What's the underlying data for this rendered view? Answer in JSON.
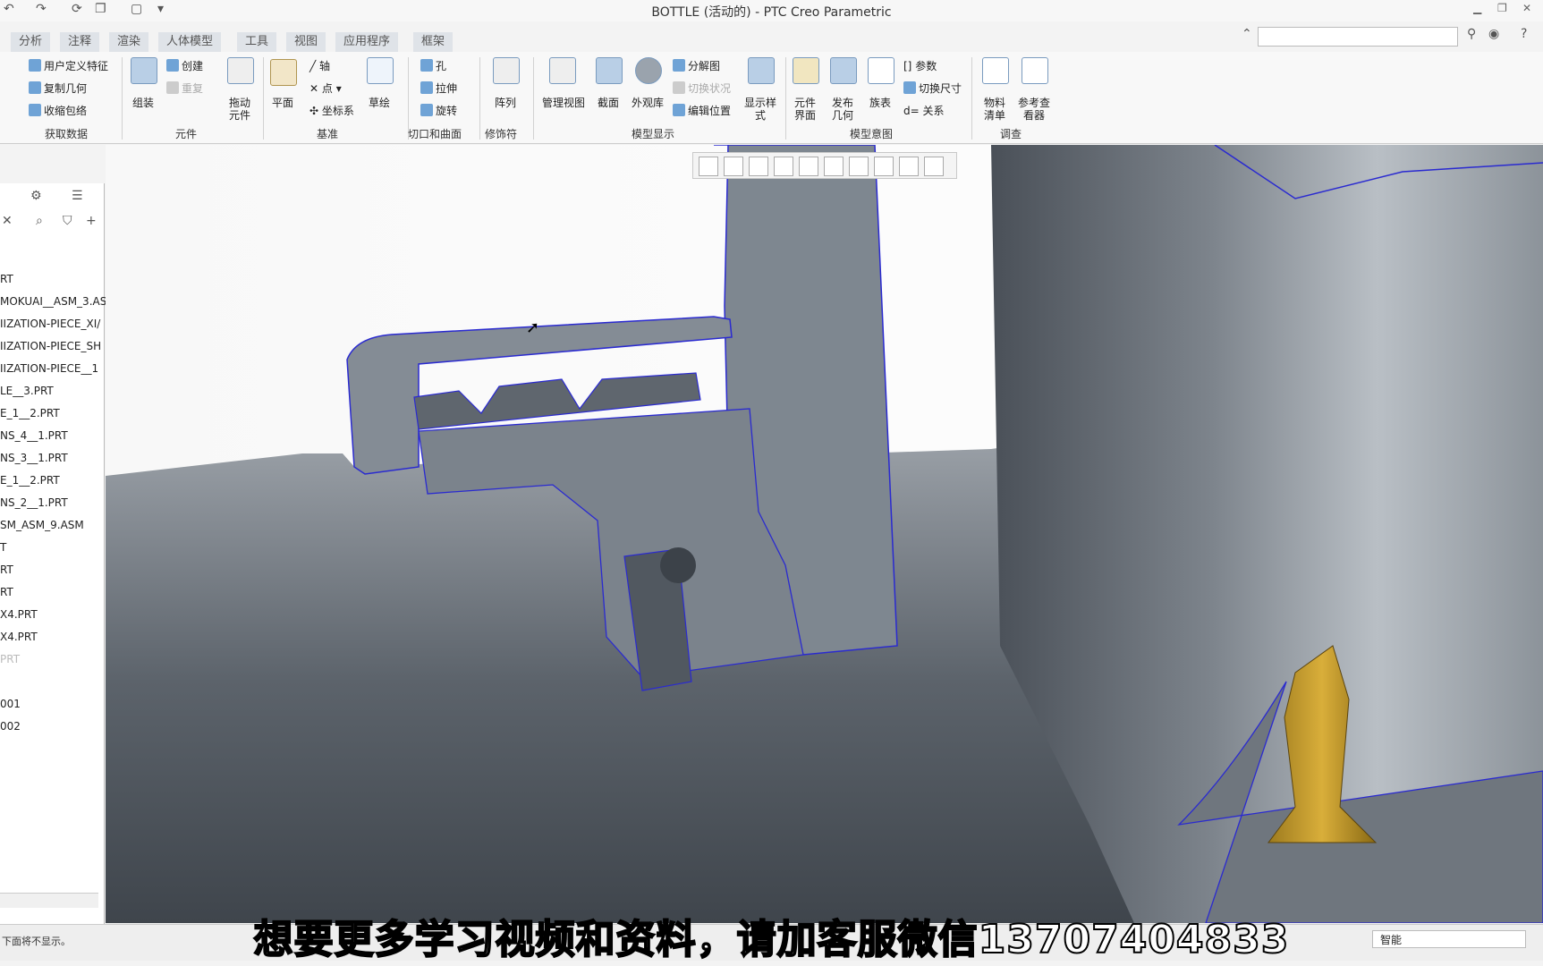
{
  "window": {
    "title": "BOTTLE (活动的) - PTC Creo Parametric"
  },
  "tabs": [
    "分析",
    "注释",
    "渲染",
    "人体模型",
    "工具",
    "视图",
    "应用程序",
    "框架"
  ],
  "ribbon": {
    "get_data": {
      "items": [
        "用户定义特征",
        "复制几何",
        "收缩包络"
      ],
      "group": "获取数据"
    },
    "component": {
      "assemble": "组装",
      "create": "创建",
      "repeat": "重复",
      "drag": "拖动\n元件",
      "group": "元件"
    },
    "datum": {
      "plane": "平面",
      "axis": "轴",
      "point": "点",
      "csys": "坐标系",
      "sketch": "草绘",
      "group": "基准"
    },
    "cut": {
      "hole": "孔",
      "extrude": "拉伸",
      "revolve": "旋转",
      "group": "切口和曲面"
    },
    "modifier": {
      "pattern": "阵列",
      "group": "修饰符"
    },
    "model_display": {
      "manage_views": "管理视图",
      "section": "截面",
      "appearance": "外观库",
      "explode": "分解图",
      "toggle_status": "切换状况",
      "edit_position": "编辑位置",
      "display_style": "显示样\n式",
      "group": "模型显示"
    },
    "model_intent": {
      "comp_interface": "元件\n界面",
      "publish_geom": "发布\n几何",
      "family_table": "族表",
      "params": "参数",
      "switch_dims": "切换尺寸",
      "relations": "关系",
      "group": "模型意图"
    },
    "investigate": {
      "bom": "物料\n清单",
      "ref_viewer": "参考查\n看器",
      "group": "调查"
    }
  },
  "model_tree": {
    "items": [
      "RT",
      "MOKUAI__ASM_3.AS",
      "IIZATION-PIECE_XI/",
      "IIZATION-PIECE_SH",
      "IIZATION-PIECE__1",
      "LE__3.PRT",
      "E_1__2.PRT",
      "NS_4__1.PRT",
      "NS_3__1.PRT",
      "E_1__2.PRT",
      "NS_2__1.PRT",
      "SM_ASM_9.ASM",
      "T",
      "RT",
      "RT",
      "X4.PRT",
      "X4.PRT",
      "PRT",
      "",
      "001",
      "002"
    ],
    "dim_index": 17
  },
  "status": {
    "message": "下面将不显示。",
    "filter": "智能"
  },
  "subtitle": "想要更多学习视频和资料，请加客服微信13707404833"
}
